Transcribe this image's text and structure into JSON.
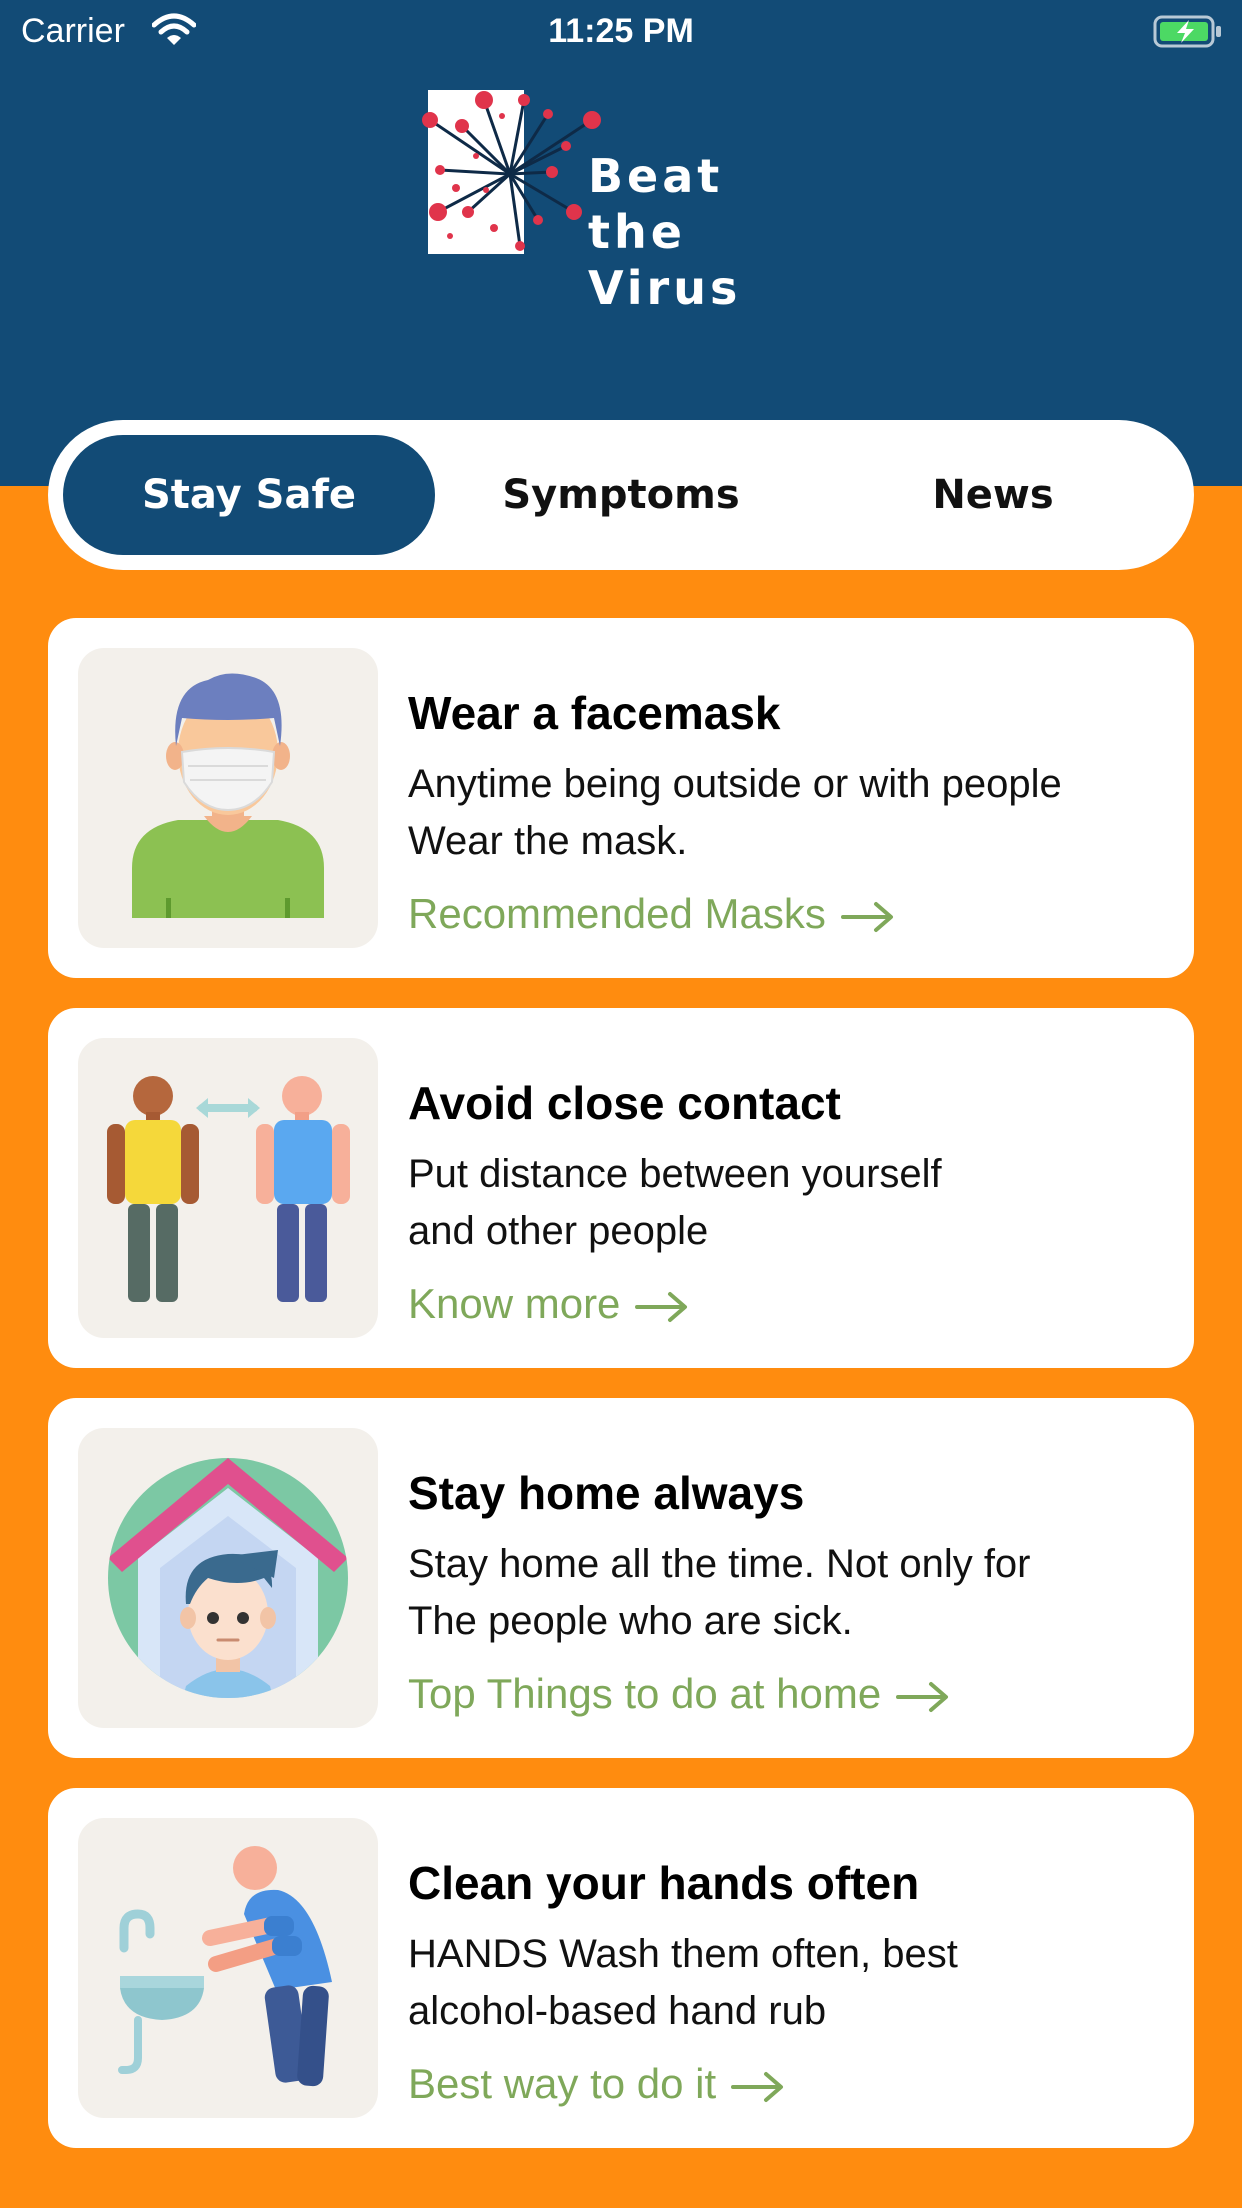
{
  "status_bar": {
    "carrier": "Carrier",
    "time": "11:25 PM"
  },
  "app": {
    "logo_line1": "Beat",
    "logo_line2": "the Virus"
  },
  "tabs": [
    {
      "label": "Stay Safe",
      "active": true
    },
    {
      "label": "Symptoms",
      "active": false
    },
    {
      "label": "News",
      "active": false
    }
  ],
  "cards": [
    {
      "title": "Wear a facemask",
      "desc_line1": "Anytime being outside or with people",
      "desc_line2": "Wear the mask.",
      "link": "Recommended Masks",
      "icon": "facemask-person"
    },
    {
      "title": "Avoid close contact",
      "desc_line1": "Put distance between yourself",
      "desc_line2": "and other people",
      "link": "Know more",
      "icon": "social-distance"
    },
    {
      "title": "Stay home always",
      "desc_line1": "Stay home all the time. Not only for",
      "desc_line2": "The people who are sick.",
      "link": "Top Things to do at home",
      "icon": "stay-home"
    },
    {
      "title": "Clean your hands often",
      "desc_line1": "HANDS Wash them often, best",
      "desc_line2": "alcohol-based hand rub",
      "link": "Best way to do it",
      "icon": "hand-washing"
    }
  ],
  "colors": {
    "header": "#124B76",
    "background": "#FF8C0F",
    "link": "#7FA85A",
    "card": "#FFFFFF"
  }
}
